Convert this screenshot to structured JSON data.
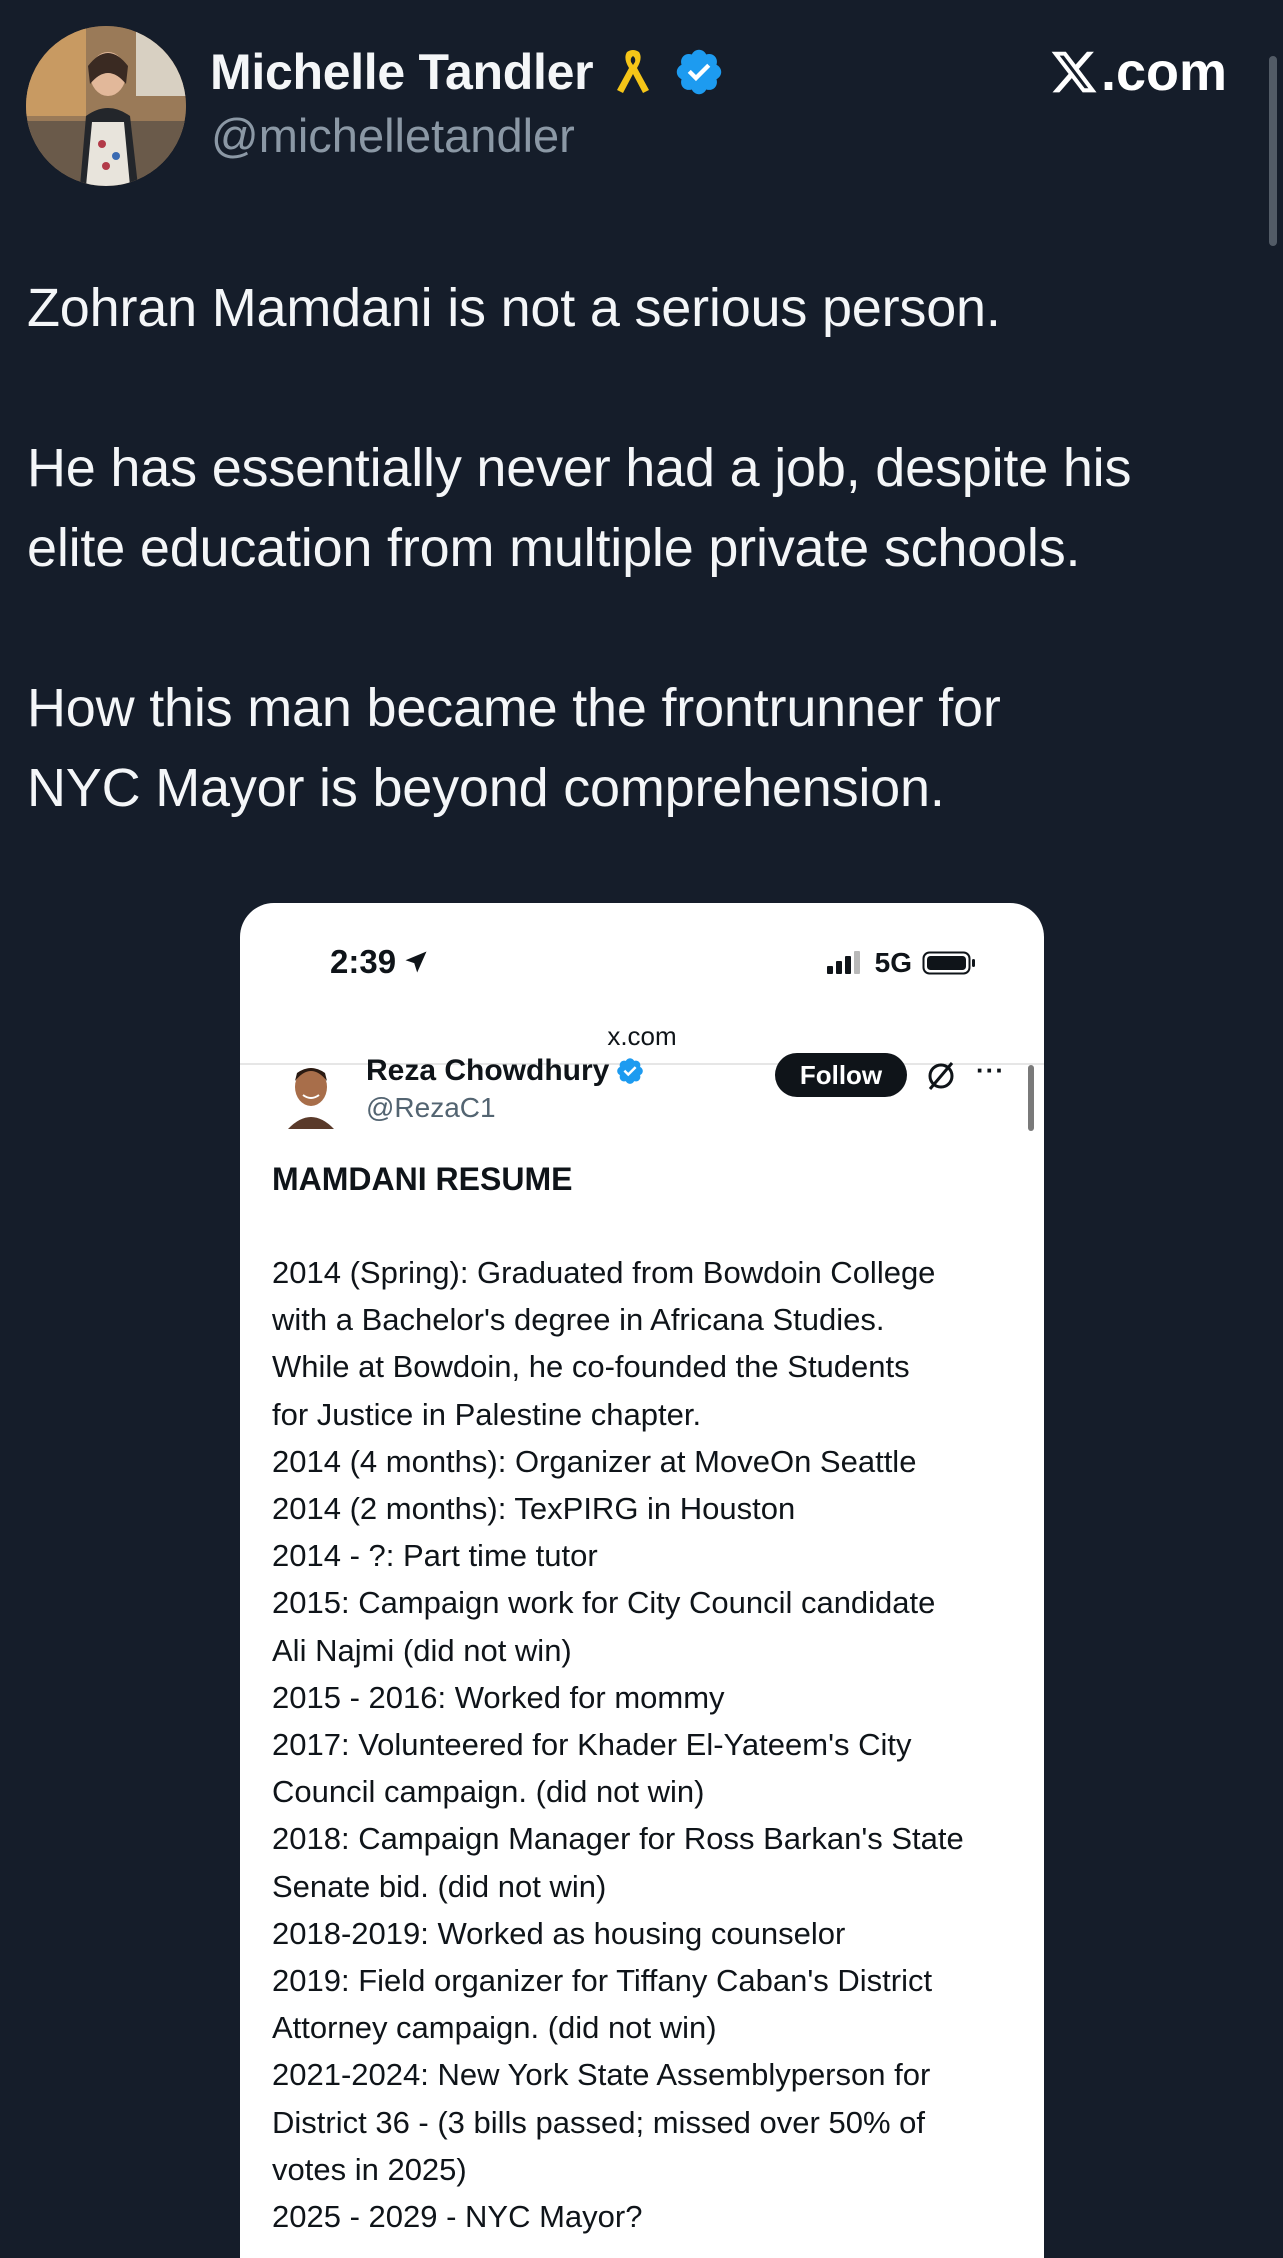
{
  "author": {
    "display_name": "Michelle Tandler",
    "handle": "@michelletandler",
    "ribbon_icon": "yellow-ribbon-icon",
    "verified_icon": "verified-badge-icon"
  },
  "brand": {
    "domain_suffix": ".com",
    "logo_icon": "x-logo-icon"
  },
  "tweet": {
    "paragraphs": [
      [
        "Zohran Mamdani is not a serious person."
      ],
      [
        "He has essentially never had a job, despite his",
        "elite education from multiple private schools."
      ],
      [
        "How this man became the frontrunner for",
        "NYC Mayor is beyond comprehension."
      ]
    ]
  },
  "media": {
    "status_time": "2:39",
    "network": "5G",
    "url": "x.com",
    "inner_author": {
      "name": "Reza Chowdhury",
      "handle": "@RezaC1"
    },
    "follow_label": "Follow",
    "more_label": "···",
    "resume_title": "MAMDANI RESUME",
    "resume_lines": [
      "2014 (Spring): Graduated from Bowdoin College",
      "with a Bachelor's degree in Africana Studies.",
      "While at Bowdoin, he co-founded the Students",
      "for Justice in Palestine chapter.",
      "2014 (4 months): Organizer at MoveOn Seattle",
      "2014 (2 months): TexPIRG in Houston",
      "2014 - ?: Part time tutor",
      "2015: Campaign work for City Council candidate",
      "Ali Najmi (did not win)",
      "2015 - 2016: Worked for mommy",
      "2017: Volunteered for Khader El-Yateem's City",
      "Council campaign. (did not win)",
      "2018: Campaign Manager for Ross Barkan's State",
      "Senate bid. (did not win)",
      "2018-2019: Worked as housing counselor",
      "2019: Field organizer for Tiffany Caban's District",
      "Attorney campaign. (did not win)",
      "2021-2024: New York State Assemblyperson for",
      "District 36 - (3 bills passed; missed over 50% of",
      "votes in 2025)",
      "2025 - 2029 - NYC Mayor?"
    ]
  },
  "colors": {
    "background": "#151d2a",
    "text_primary": "#f4f6f8",
    "text_secondary": "#8b98a5",
    "verified_blue": "#1d9bf0",
    "ribbon_yellow": "#f5c518"
  }
}
